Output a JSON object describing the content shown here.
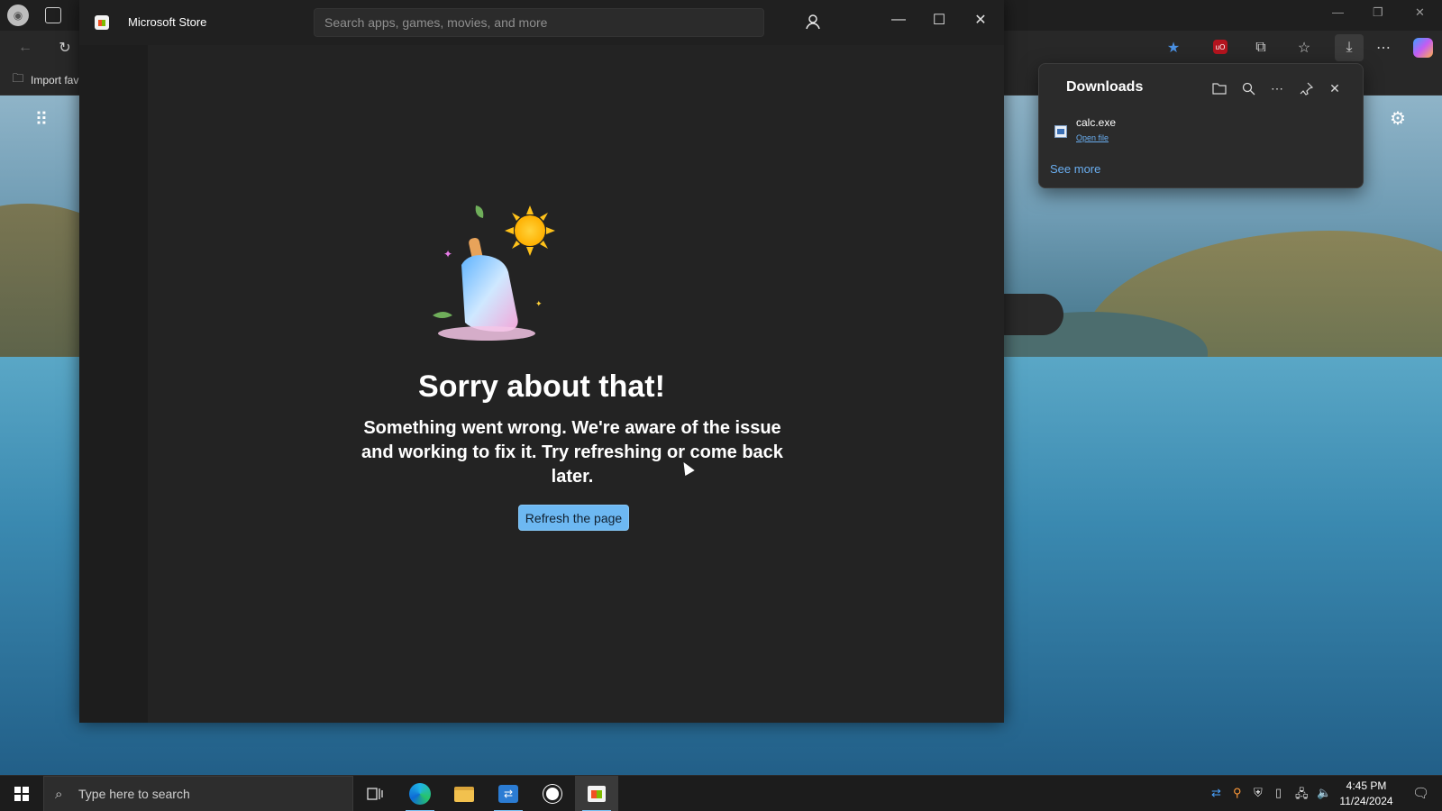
{
  "browser": {
    "favorites_bar": {
      "import_label": "Import fav"
    }
  },
  "store": {
    "title": "Microsoft Store",
    "search": {
      "placeholder": "Search apps, games, movies, and more",
      "value": ""
    },
    "error": {
      "heading": "Sorry about that!",
      "message": "Something went wrong. We're aware of the issue and working to fix it. Try refreshing or come back later.",
      "refresh_label": "Refresh the page"
    }
  },
  "downloads": {
    "title": "Downloads",
    "items": [
      {
        "filename": "calc.exe",
        "action": "Open file"
      }
    ],
    "see_more": "See more"
  },
  "taskbar": {
    "search_placeholder": "Type here to search",
    "time": "4:45 PM",
    "date": "11/24/2024"
  },
  "colors": {
    "accent": "#6db8f2",
    "link": "#6aaef0",
    "window_bg": "#202020"
  }
}
